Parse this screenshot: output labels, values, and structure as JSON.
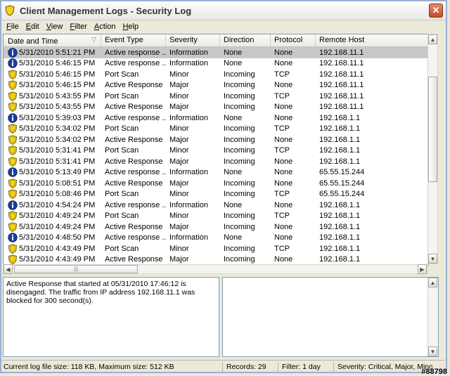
{
  "window": {
    "title": "Client Management Logs - Security Log"
  },
  "menu": [
    {
      "label": "File",
      "u": "F",
      "rest": "ile"
    },
    {
      "label": "Edit",
      "u": "E",
      "rest": "dit"
    },
    {
      "label": "View",
      "u": "V",
      "rest": "iew"
    },
    {
      "label": "Filter",
      "u": "F",
      "rest": "ilter"
    },
    {
      "label": "Action",
      "u": "A",
      "rest": "ction"
    },
    {
      "label": "Help",
      "u": "H",
      "rest": "elp"
    }
  ],
  "columns": [
    "Date and Time",
    "Event Type",
    "Severity",
    "Direction",
    "Protocol",
    "Remote Host"
  ],
  "rows": [
    {
      "icon": "info",
      "time": "5/31/2010 5:51:21 PM",
      "event": "Active response ...",
      "severity": "Information",
      "direction": "None",
      "protocol": "None",
      "host": "192.168.11.1",
      "selected": true
    },
    {
      "icon": "info",
      "time": "5/31/2010 5:46:15 PM",
      "event": "Active response ...",
      "severity": "Information",
      "direction": "None",
      "protocol": "None",
      "host": "192.168.11.1"
    },
    {
      "icon": "shield",
      "time": "5/31/2010 5:46:15 PM",
      "event": "Port Scan",
      "severity": "Minor",
      "direction": "Incoming",
      "protocol": "TCP",
      "host": "192.168.11.1"
    },
    {
      "icon": "shield",
      "time": "5/31/2010 5:46:15 PM",
      "event": "Active Response",
      "severity": "Major",
      "direction": "Incoming",
      "protocol": "None",
      "host": "192.168.11.1"
    },
    {
      "icon": "shield",
      "time": "5/31/2010 5:43:55 PM",
      "event": "Port Scan",
      "severity": "Minor",
      "direction": "Incoming",
      "protocol": "TCP",
      "host": "192.168.11.1"
    },
    {
      "icon": "shield",
      "time": "5/31/2010 5:43:55 PM",
      "event": "Active Response",
      "severity": "Major",
      "direction": "Incoming",
      "protocol": "None",
      "host": "192.168.11.1"
    },
    {
      "icon": "info",
      "time": "5/31/2010 5:39:03 PM",
      "event": "Active response ...",
      "severity": "Information",
      "direction": "None",
      "protocol": "None",
      "host": "192.168.1.1"
    },
    {
      "icon": "shield",
      "time": "5/31/2010 5:34:02 PM",
      "event": "Port Scan",
      "severity": "Minor",
      "direction": "Incoming",
      "protocol": "TCP",
      "host": "192.168.1.1"
    },
    {
      "icon": "shield",
      "time": "5/31/2010 5:34:02 PM",
      "event": "Active Response",
      "severity": "Major",
      "direction": "Incoming",
      "protocol": "None",
      "host": "192.168.1.1"
    },
    {
      "icon": "shield",
      "time": "5/31/2010 5:31:41 PM",
      "event": "Port Scan",
      "severity": "Minor",
      "direction": "Incoming",
      "protocol": "TCP",
      "host": "192.168.1.1"
    },
    {
      "icon": "shield",
      "time": "5/31/2010 5:31:41 PM",
      "event": "Active Response",
      "severity": "Major",
      "direction": "Incoming",
      "protocol": "None",
      "host": "192.168.1.1"
    },
    {
      "icon": "info",
      "time": "5/31/2010 5:13:49 PM",
      "event": "Active response ...",
      "severity": "Information",
      "direction": "None",
      "protocol": "None",
      "host": "65.55.15.244"
    },
    {
      "icon": "shield",
      "time": "5/31/2010 5:08:51 PM",
      "event": "Active Response",
      "severity": "Major",
      "direction": "Incoming",
      "protocol": "None",
      "host": "65.55.15.244"
    },
    {
      "icon": "shield",
      "time": "5/31/2010 5:08:46 PM",
      "event": "Port Scan",
      "severity": "Minor",
      "direction": "Incoming",
      "protocol": "TCP",
      "host": "65.55.15.244"
    },
    {
      "icon": "info",
      "time": "5/31/2010 4:54:24 PM",
      "event": "Active response ...",
      "severity": "Information",
      "direction": "None",
      "protocol": "None",
      "host": "192.168.1.1"
    },
    {
      "icon": "shield",
      "time": "5/31/2010 4:49:24 PM",
      "event": "Port Scan",
      "severity": "Minor",
      "direction": "Incoming",
      "protocol": "TCP",
      "host": "192.168.1.1"
    },
    {
      "icon": "shield",
      "time": "5/31/2010 4:49:24 PM",
      "event": "Active Response",
      "severity": "Major",
      "direction": "Incoming",
      "protocol": "None",
      "host": "192.168.1.1"
    },
    {
      "icon": "info",
      "time": "5/31/2010 4:48:50 PM",
      "event": "Active response ...",
      "severity": "Information",
      "direction": "None",
      "protocol": "None",
      "host": "192.168.1.1"
    },
    {
      "icon": "shield",
      "time": "5/31/2010 4:43:49 PM",
      "event": "Port Scan",
      "severity": "Minor",
      "direction": "Incoming",
      "protocol": "TCP",
      "host": "192.168.1.1"
    },
    {
      "icon": "shield",
      "time": "5/31/2010 4:43:49 PM",
      "event": "Active Response",
      "severity": "Major",
      "direction": "Incoming",
      "protocol": "None",
      "host": "192.168.1.1"
    }
  ],
  "detail": {
    "text": "Active Response that started at 05/31/2010 17:46:12 is disengaged. The traffic from IP address 192.168.11.1 was blocked for 300 second(s)."
  },
  "status": {
    "file_size": "Current log file size: 118 KB, Maximum size: 512 KB",
    "records": "Records: 29",
    "filter": "Filter: 1 day",
    "severity": "Severity: Critical, Major, Mino"
  },
  "watermark": "#88798",
  "icons": {
    "info": "info-icon",
    "shield": "shield-icon"
  },
  "colors": {
    "info_blue": "#1a3e9c",
    "shield_yellow": "#f2d31b",
    "selected_row": "#c8c8c8"
  }
}
